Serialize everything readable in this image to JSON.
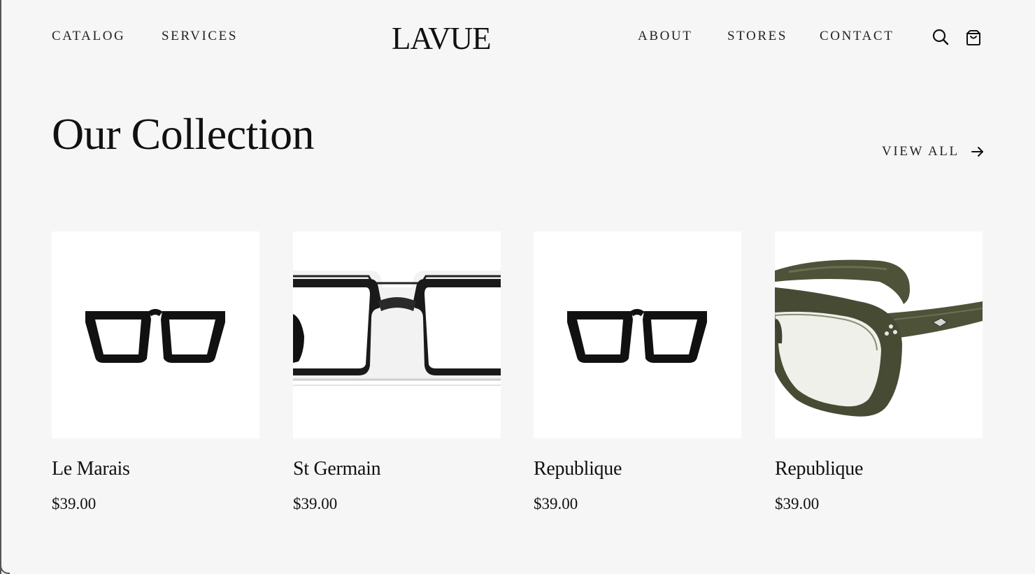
{
  "nav": {
    "left": [
      "CATALOG",
      "SERVICES"
    ],
    "right": [
      "ABOUT",
      "STORES",
      "CONTACT"
    ]
  },
  "brand": {
    "logo": "LAVUE"
  },
  "icons": {
    "search": "search-icon",
    "cart": "shopping-bag-icon",
    "arrow": "arrow-right-icon"
  },
  "collection": {
    "title": "Our Collection",
    "view_all": "VIEW ALL",
    "products": [
      {
        "name": "Le Marais",
        "price": "$39.00",
        "image": "black-square-glasses"
      },
      {
        "name": "St Germain",
        "price": "$39.00",
        "image": "clear-black-glasses-closeup"
      },
      {
        "name": "Republique",
        "price": "$39.00",
        "image": "black-square-glasses"
      },
      {
        "name": "Republique",
        "price": "$39.00",
        "image": "olive-green-glasses-angled"
      }
    ]
  },
  "colors": {
    "background": "#f6f6f6",
    "card": "#ffffff",
    "text": "#111111",
    "olive_frame": "#4e5239"
  }
}
